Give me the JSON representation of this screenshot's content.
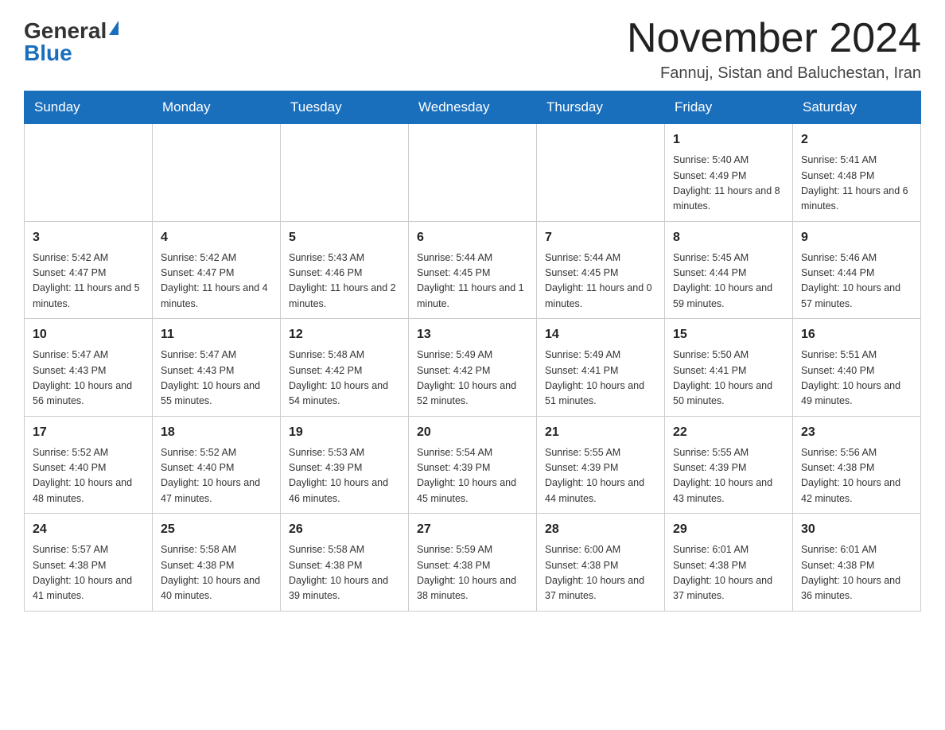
{
  "header": {
    "logo_general": "General",
    "logo_blue": "Blue",
    "month_title": "November 2024",
    "subtitle": "Fannuj, Sistan and Baluchestan, Iran"
  },
  "weekdays": [
    "Sunday",
    "Monday",
    "Tuesday",
    "Wednesday",
    "Thursday",
    "Friday",
    "Saturday"
  ],
  "weeks": [
    [
      {
        "day": "",
        "info": ""
      },
      {
        "day": "",
        "info": ""
      },
      {
        "day": "",
        "info": ""
      },
      {
        "day": "",
        "info": ""
      },
      {
        "day": "",
        "info": ""
      },
      {
        "day": "1",
        "info": "Sunrise: 5:40 AM\nSunset: 4:49 PM\nDaylight: 11 hours and 8 minutes."
      },
      {
        "day": "2",
        "info": "Sunrise: 5:41 AM\nSunset: 4:48 PM\nDaylight: 11 hours and 6 minutes."
      }
    ],
    [
      {
        "day": "3",
        "info": "Sunrise: 5:42 AM\nSunset: 4:47 PM\nDaylight: 11 hours and 5 minutes."
      },
      {
        "day": "4",
        "info": "Sunrise: 5:42 AM\nSunset: 4:47 PM\nDaylight: 11 hours and 4 minutes."
      },
      {
        "day": "5",
        "info": "Sunrise: 5:43 AM\nSunset: 4:46 PM\nDaylight: 11 hours and 2 minutes."
      },
      {
        "day": "6",
        "info": "Sunrise: 5:44 AM\nSunset: 4:45 PM\nDaylight: 11 hours and 1 minute."
      },
      {
        "day": "7",
        "info": "Sunrise: 5:44 AM\nSunset: 4:45 PM\nDaylight: 11 hours and 0 minutes."
      },
      {
        "day": "8",
        "info": "Sunrise: 5:45 AM\nSunset: 4:44 PM\nDaylight: 10 hours and 59 minutes."
      },
      {
        "day": "9",
        "info": "Sunrise: 5:46 AM\nSunset: 4:44 PM\nDaylight: 10 hours and 57 minutes."
      }
    ],
    [
      {
        "day": "10",
        "info": "Sunrise: 5:47 AM\nSunset: 4:43 PM\nDaylight: 10 hours and 56 minutes."
      },
      {
        "day": "11",
        "info": "Sunrise: 5:47 AM\nSunset: 4:43 PM\nDaylight: 10 hours and 55 minutes."
      },
      {
        "day": "12",
        "info": "Sunrise: 5:48 AM\nSunset: 4:42 PM\nDaylight: 10 hours and 54 minutes."
      },
      {
        "day": "13",
        "info": "Sunrise: 5:49 AM\nSunset: 4:42 PM\nDaylight: 10 hours and 52 minutes."
      },
      {
        "day": "14",
        "info": "Sunrise: 5:49 AM\nSunset: 4:41 PM\nDaylight: 10 hours and 51 minutes."
      },
      {
        "day": "15",
        "info": "Sunrise: 5:50 AM\nSunset: 4:41 PM\nDaylight: 10 hours and 50 minutes."
      },
      {
        "day": "16",
        "info": "Sunrise: 5:51 AM\nSunset: 4:40 PM\nDaylight: 10 hours and 49 minutes."
      }
    ],
    [
      {
        "day": "17",
        "info": "Sunrise: 5:52 AM\nSunset: 4:40 PM\nDaylight: 10 hours and 48 minutes."
      },
      {
        "day": "18",
        "info": "Sunrise: 5:52 AM\nSunset: 4:40 PM\nDaylight: 10 hours and 47 minutes."
      },
      {
        "day": "19",
        "info": "Sunrise: 5:53 AM\nSunset: 4:39 PM\nDaylight: 10 hours and 46 minutes."
      },
      {
        "day": "20",
        "info": "Sunrise: 5:54 AM\nSunset: 4:39 PM\nDaylight: 10 hours and 45 minutes."
      },
      {
        "day": "21",
        "info": "Sunrise: 5:55 AM\nSunset: 4:39 PM\nDaylight: 10 hours and 44 minutes."
      },
      {
        "day": "22",
        "info": "Sunrise: 5:55 AM\nSunset: 4:39 PM\nDaylight: 10 hours and 43 minutes."
      },
      {
        "day": "23",
        "info": "Sunrise: 5:56 AM\nSunset: 4:38 PM\nDaylight: 10 hours and 42 minutes."
      }
    ],
    [
      {
        "day": "24",
        "info": "Sunrise: 5:57 AM\nSunset: 4:38 PM\nDaylight: 10 hours and 41 minutes."
      },
      {
        "day": "25",
        "info": "Sunrise: 5:58 AM\nSunset: 4:38 PM\nDaylight: 10 hours and 40 minutes."
      },
      {
        "day": "26",
        "info": "Sunrise: 5:58 AM\nSunset: 4:38 PM\nDaylight: 10 hours and 39 minutes."
      },
      {
        "day": "27",
        "info": "Sunrise: 5:59 AM\nSunset: 4:38 PM\nDaylight: 10 hours and 38 minutes."
      },
      {
        "day": "28",
        "info": "Sunrise: 6:00 AM\nSunset: 4:38 PM\nDaylight: 10 hours and 37 minutes."
      },
      {
        "day": "29",
        "info": "Sunrise: 6:01 AM\nSunset: 4:38 PM\nDaylight: 10 hours and 37 minutes."
      },
      {
        "day": "30",
        "info": "Sunrise: 6:01 AM\nSunset: 4:38 PM\nDaylight: 10 hours and 36 minutes."
      }
    ]
  ]
}
